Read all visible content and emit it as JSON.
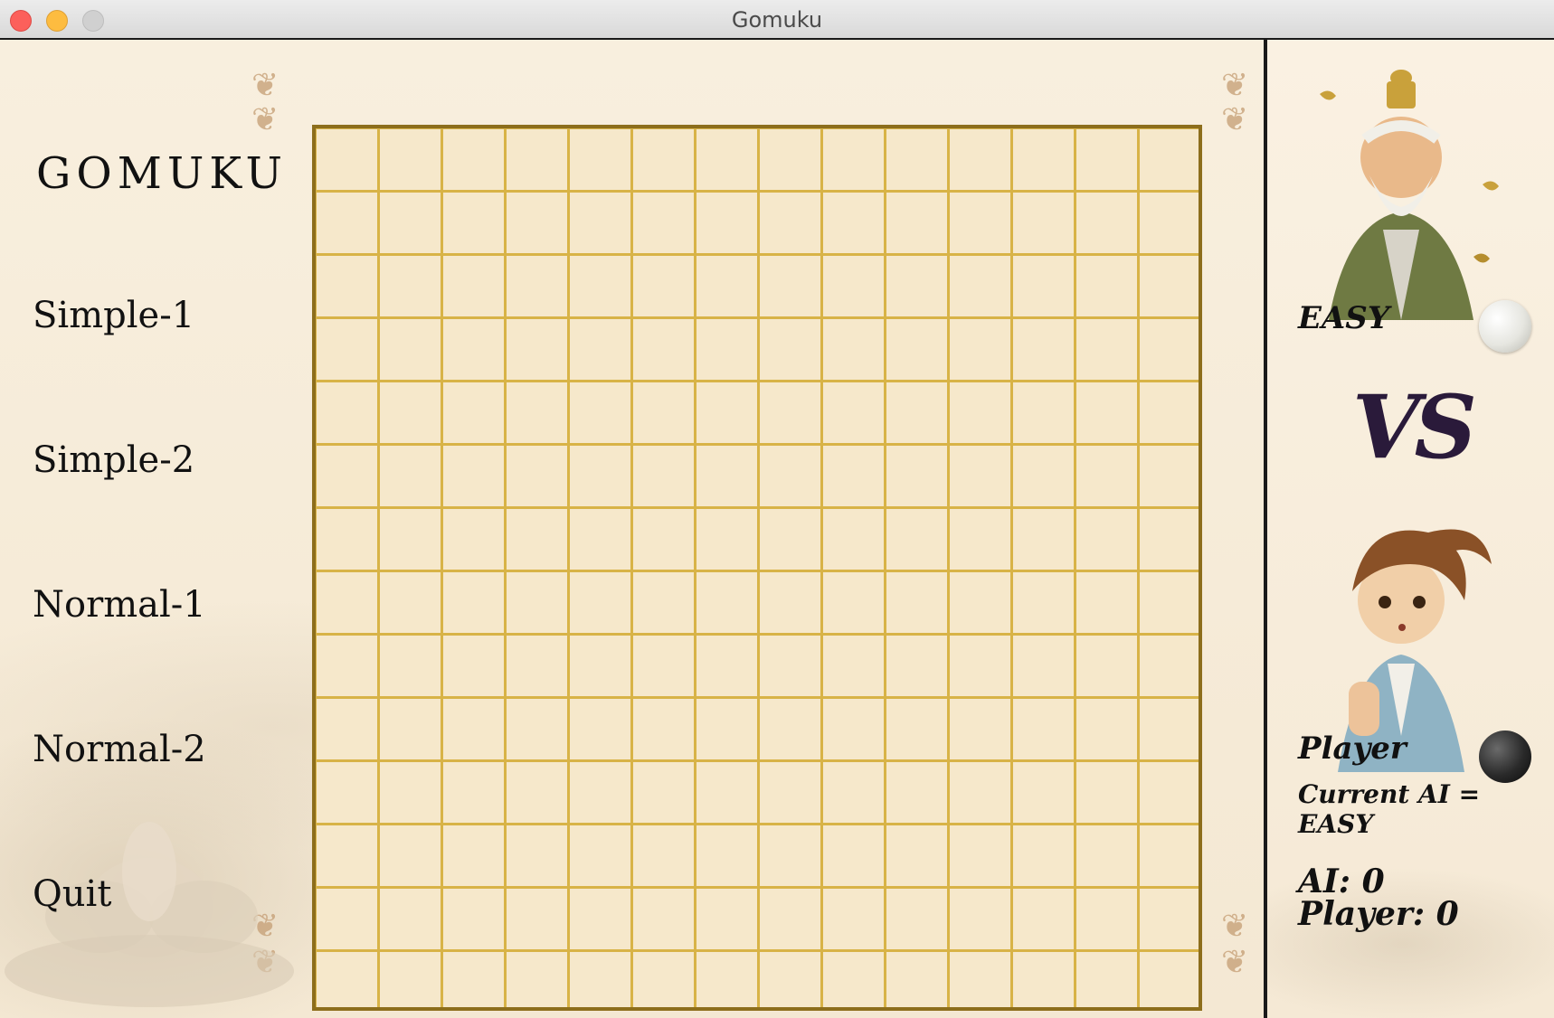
{
  "window": {
    "title": "Gomuku"
  },
  "sidebar": {
    "logo": "GOMUKU",
    "items": [
      {
        "label": "Simple-1"
      },
      {
        "label": "Simple-2"
      },
      {
        "label": "Normal-1"
      },
      {
        "label": "Normal-2"
      },
      {
        "label": "Quit"
      }
    ]
  },
  "board": {
    "rows": 14,
    "cols": 14,
    "stones": []
  },
  "players": {
    "ai": {
      "label": "EASY",
      "stone": "white"
    },
    "vs": "VS",
    "player": {
      "label": "Player",
      "stone": "black"
    }
  },
  "status": {
    "current_ai": "Current AI = EASY",
    "ai_score": "AI: 0",
    "player_score": "Player: 0"
  },
  "colors": {
    "board_background": "#f6e8cb",
    "grid_line": "#d8b347",
    "board_border": "#8d6e1c"
  }
}
